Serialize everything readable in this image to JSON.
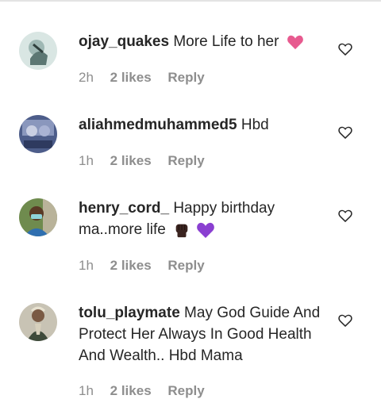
{
  "comments": [
    {
      "username": "ojay_quakes",
      "text": "More Life to her",
      "emoji": [
        "pink-heart-icon"
      ],
      "time": "2h",
      "likes": "2 likes",
      "reply": "Reply"
    },
    {
      "username": "aliahmedmuhammed5",
      "text": "Hbd",
      "emoji": [],
      "time": "1h",
      "likes": "2 likes",
      "reply": "Reply"
    },
    {
      "username": "henry_cord_",
      "text": "Happy birthday ma..more life",
      "emoji": [
        "raised-fist-dark-icon",
        "purple-heart-icon"
      ],
      "time": "1h",
      "likes": "2 likes",
      "reply": "Reply"
    },
    {
      "username": "tolu_playmate",
      "text": "May God Guide And Protect Her Always In Good Health And Wealth.. Hbd Mama",
      "emoji": [],
      "time": "1h",
      "likes": "2 likes",
      "reply": "Reply"
    }
  ],
  "colors": {
    "text": "#262626",
    "meta": "#8e8e8e",
    "pink_heart": "#e75a8f",
    "purple_heart": "#8a3fd1"
  }
}
